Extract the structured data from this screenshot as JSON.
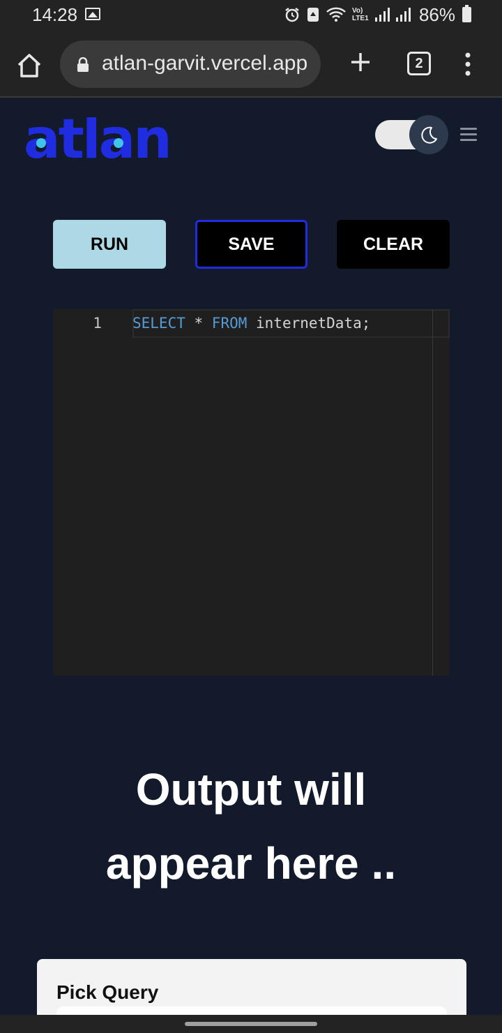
{
  "status_bar": {
    "time": "14:28",
    "network": "Vo) LTE1",
    "battery": "86%"
  },
  "browser": {
    "url": "atlan-garvit.vercel.app",
    "tab_count": "2"
  },
  "app": {
    "logo_text": "atlan",
    "brand_color": "#1f2ce0",
    "theme": "dark"
  },
  "toolbar": {
    "run_label": "RUN",
    "save_label": "SAVE",
    "clear_label": "CLEAR"
  },
  "editor": {
    "line_number": "1",
    "kw_select": "SELECT",
    "star": " * ",
    "kw_from": "FROM",
    "table": " internetData;"
  },
  "output": {
    "line1": "Output will",
    "line2": "appear here .."
  },
  "query_picker": {
    "title": "Pick Query"
  }
}
